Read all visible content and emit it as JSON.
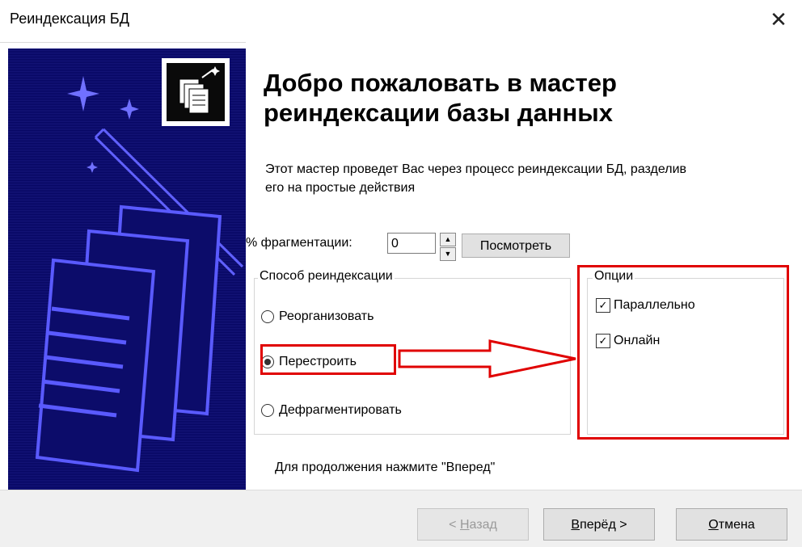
{
  "window": {
    "title": "Реиндексация БД",
    "close_glyph": "✕"
  },
  "main": {
    "heading_line1": "Добро пожаловать в мастер",
    "heading_line2": "реиндексации базы данных",
    "description_line1": "Этот мастер проведет Вас через процесс реиндексации БД, разделив",
    "description_line2": "его на простые действия",
    "fragmentation_label": "% фрагментации:",
    "fragmentation_value": "0",
    "view_button": "Посмотреть",
    "method_group_label": "Способ реиндексации",
    "method_options": [
      "Реорганизовать",
      "Перестроить",
      "Дефрагментировать"
    ],
    "method_selected": "Перестроить",
    "options_group_label": "Опции",
    "options": [
      {
        "label": "Параллельно",
        "checked": true
      },
      {
        "label": "Онлайн",
        "checked": true
      }
    ],
    "continue_hint": "Для продолжения нажмите \"Вперед\""
  },
  "footer": {
    "back_button": {
      "accel": "Н",
      "rest": "азад",
      "prefix": "< ",
      "disabled": true
    },
    "next_button": {
      "accel": "В",
      "rest": "перёд",
      "suffix": " >"
    },
    "cancel_button": {
      "accel": "О",
      "rest": "тмена"
    }
  },
  "colors": {
    "sidebar_bg": "#0a0a66",
    "highlight": "#e00000"
  },
  "icons": [
    "sparkle-icon",
    "wizard-documents-icon",
    "documents-illustration",
    "arrow-annotation"
  ]
}
